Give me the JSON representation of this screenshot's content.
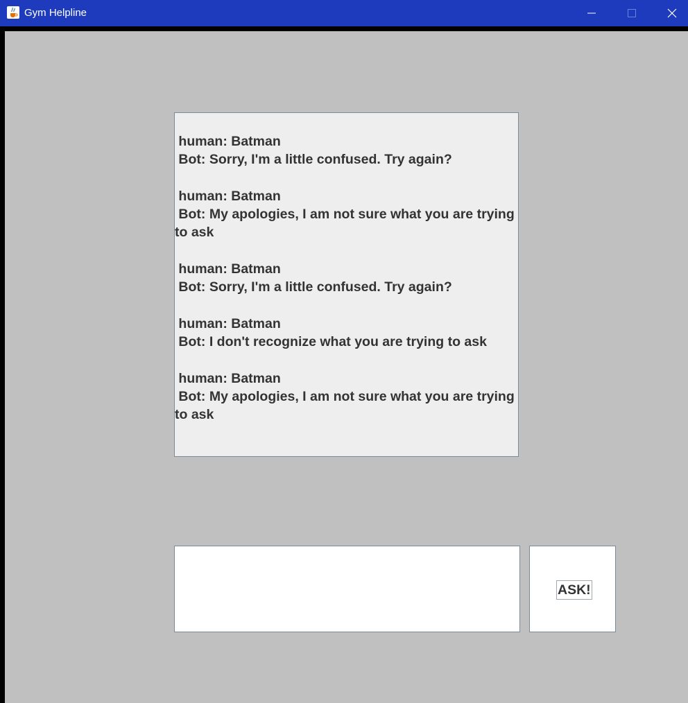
{
  "window": {
    "title": "Gym Helpline",
    "icon": "java-cup-icon",
    "controls": [
      "minimize",
      "maximize",
      "close"
    ],
    "titlebar_color": "#1f3bbd"
  },
  "chat": {
    "transcript": " human: Batman\n Bot: Sorry, I'm a little confused. Try again?\n\n human: Batman\n Bot: My apologies, I am not sure what you are trying to ask\n\n human: Batman\n Bot: Sorry, I'm a little confused. Try again?\n\n human: Batman\n Bot: I don't recognize what you are trying to ask\n\n human: Batman\n Bot: My apologies, I am not sure what you are trying to ask"
  },
  "input": {
    "value": ""
  },
  "ask_button": {
    "label": "ASK!"
  }
}
